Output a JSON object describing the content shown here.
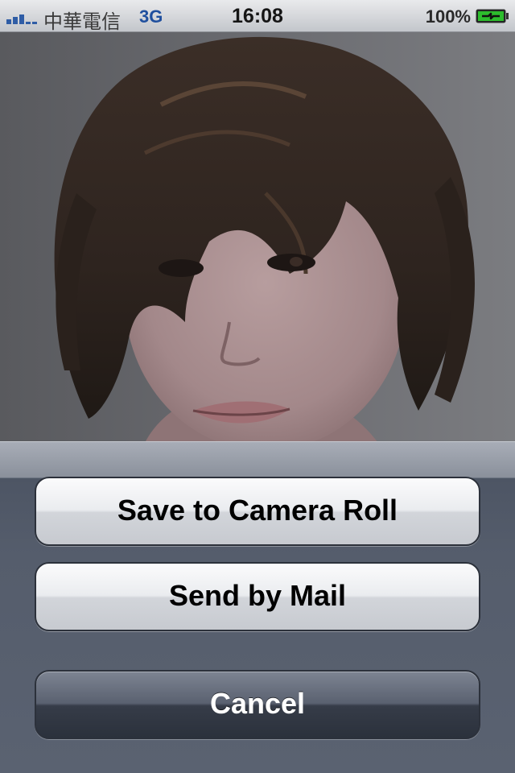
{
  "status_bar": {
    "carrier": "中華電信",
    "network": "3G",
    "time": "16:08",
    "battery_percent": "100%",
    "signal_icon": "signal-bars-icon",
    "battery_icon": "battery-charging-icon"
  },
  "photo": {
    "subject": "portrait-photo"
  },
  "action_sheet": {
    "save_label": "Save to Camera Roll",
    "mail_label": "Send by Mail",
    "cancel_label": "Cancel"
  },
  "colors": {
    "network_blue": "#1f4f9e",
    "battery_green": "#2dbd2d",
    "sheet_background": "#555d6c",
    "cancel_button": "#363c48"
  }
}
